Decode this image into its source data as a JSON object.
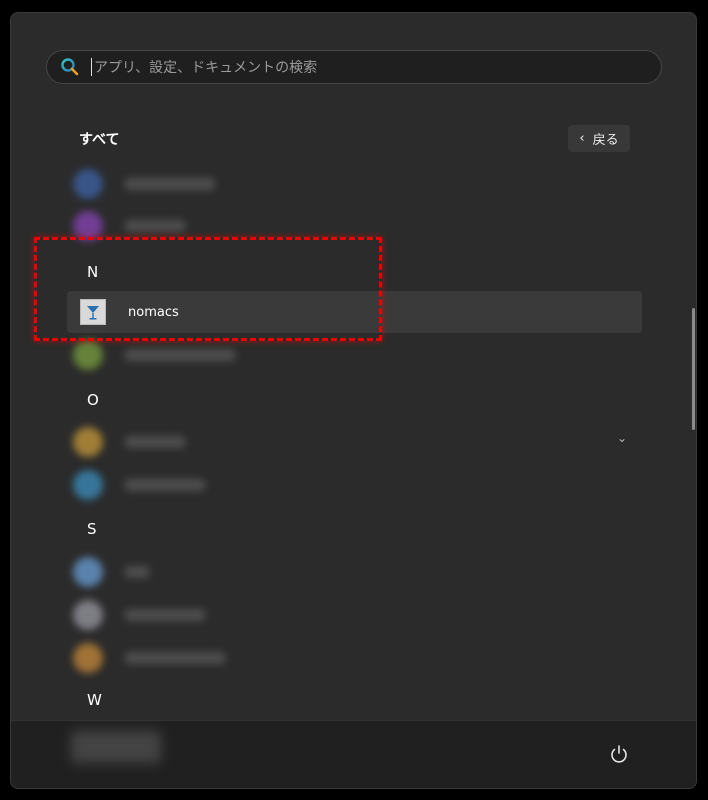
{
  "search": {
    "placeholder": "アプリ、設定、ドキュメントの検索"
  },
  "list": {
    "heading": "すべて",
    "back_label": "戻る",
    "letters": {
      "n": "N",
      "o": "O",
      "s": "S",
      "w": "W"
    },
    "apps": [
      {
        "name": "nomacs",
        "icon": "nomacs-cocktail-icon",
        "selected": true
      }
    ]
  },
  "colors": {
    "panel_bg": "#2b2b2b",
    "highlight_border": "#e00000",
    "search_icon_accent": "#2ea6a6"
  }
}
